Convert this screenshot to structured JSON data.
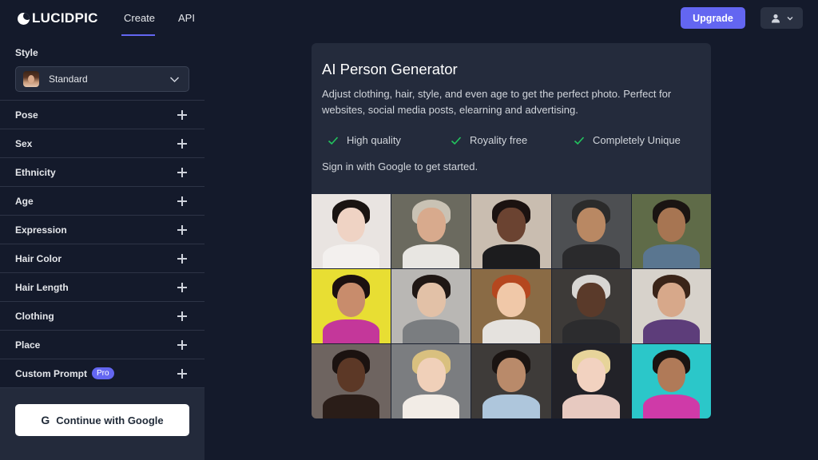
{
  "brand": {
    "name": "LUCIDPIC"
  },
  "nav": {
    "tabs": [
      {
        "label": "Create",
        "active": true
      },
      {
        "label": "API",
        "active": false
      }
    ],
    "upgrade_label": "Upgrade"
  },
  "sidebar": {
    "style_label": "Style",
    "style_value": "Standard",
    "items": [
      {
        "label": "Pose"
      },
      {
        "label": "Sex"
      },
      {
        "label": "Ethnicity"
      },
      {
        "label": "Age"
      },
      {
        "label": "Expression"
      },
      {
        "label": "Hair Color"
      },
      {
        "label": "Hair Length"
      },
      {
        "label": "Clothing"
      },
      {
        "label": "Place"
      },
      {
        "label": "Custom Prompt",
        "badge": "Pro"
      }
    ],
    "google_button_label": "Continue with Google",
    "google_icon": "G"
  },
  "main": {
    "title": "AI Person Generator",
    "description": "Adjust clothing, hair, style, and even age to get the perfect photo. Perfect for websites, social media posts, elearning and advertising.",
    "features": [
      "High quality",
      "Royality free",
      "Completely Unique"
    ],
    "signin_text": "Sign in with Google to get started."
  },
  "colors": {
    "background": "#141a2b",
    "card": "#242b3c",
    "accent": "#6366f1",
    "check": "#22c55e"
  },
  "gallery": [
    {
      "bg": "#e9e4e1",
      "hair": "#1a1412",
      "face": "#efd3c4",
      "body": "#f3f0ee"
    },
    {
      "bg": "#6b6a5f",
      "hair": "#c9c2b4",
      "face": "#d8aa8d",
      "body": "#e8e6e2"
    },
    {
      "bg": "#c9bdb0",
      "hair": "#1b1210",
      "face": "#6b4331",
      "body": "#1c1c1e"
    },
    {
      "bg": "#4d4f52",
      "hair": "#2b2b2b",
      "face": "#b98863",
      "body": "#2a2a2c"
    },
    {
      "bg": "#5f6b48",
      "hair": "#1a1412",
      "face": "#a77552",
      "body": "#5a7690"
    },
    {
      "bg": "#e8de33",
      "hair": "#1b1010",
      "face": "#c88c6c",
      "body": "#c4379a"
    },
    {
      "bg": "#b9b7b4",
      "hair": "#1f1714",
      "face": "#e2c1a7",
      "body": "#7a7d80"
    },
    {
      "bg": "#8a6b45",
      "hair": "#b5471f",
      "face": "#f0c8a8",
      "body": "#e5e2de"
    },
    {
      "bg": "#3d3a38",
      "hair": "#d8d6d3",
      "face": "#5a3a2a",
      "body": "#2c2c2e"
    },
    {
      "bg": "#d7d2cb",
      "hair": "#3a2418",
      "face": "#d7a88a",
      "body": "#5d3d7a"
    },
    {
      "bg": "#6e6460",
      "hair": "#1b1210",
      "face": "#5c3826",
      "body": "#2a1d18"
    },
    {
      "bg": "#7b7d80",
      "hair": "#d9c07f",
      "face": "#f0d0b9",
      "body": "#f2ece6"
    },
    {
      "bg": "#3e3b39",
      "hair": "#1a1412",
      "face": "#b98a6a",
      "body": "#aec6dc"
    },
    {
      "bg": "#222228",
      "hair": "#e7d49a",
      "face": "#f2d2c0",
      "body": "#e7c9c0"
    },
    {
      "bg": "#2bc7c9",
      "hair": "#1a1412",
      "face": "#b07a58",
      "body": "#cf3aa8"
    }
  ]
}
